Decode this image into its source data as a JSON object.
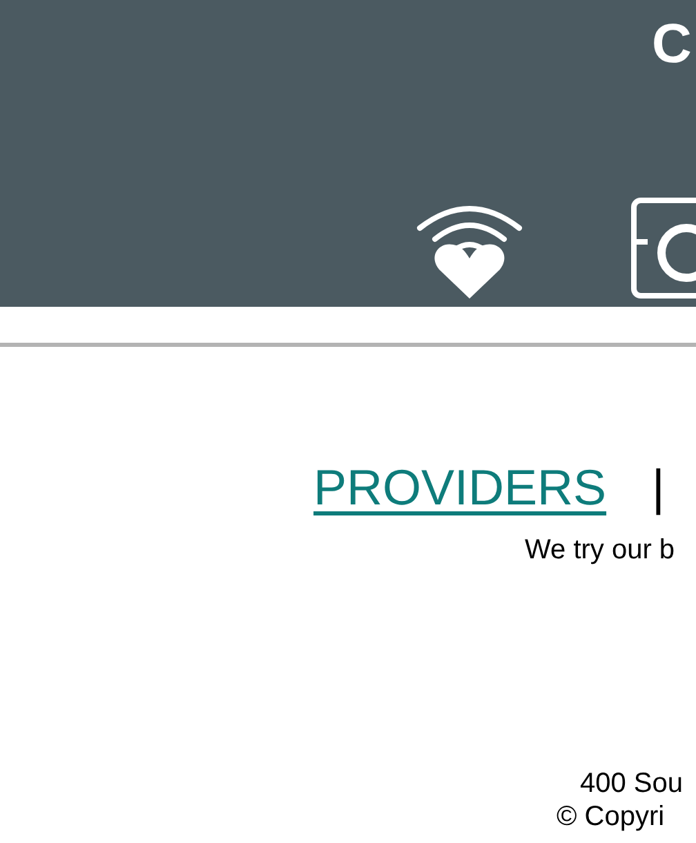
{
  "header": {
    "title": "C"
  },
  "nav": {
    "links": [
      {
        "label": "PROVIDERS"
      }
    ],
    "separator": "|"
  },
  "intro": "We try our b",
  "footer": {
    "address": "400 Sou",
    "copyright": "© Copyri"
  }
}
